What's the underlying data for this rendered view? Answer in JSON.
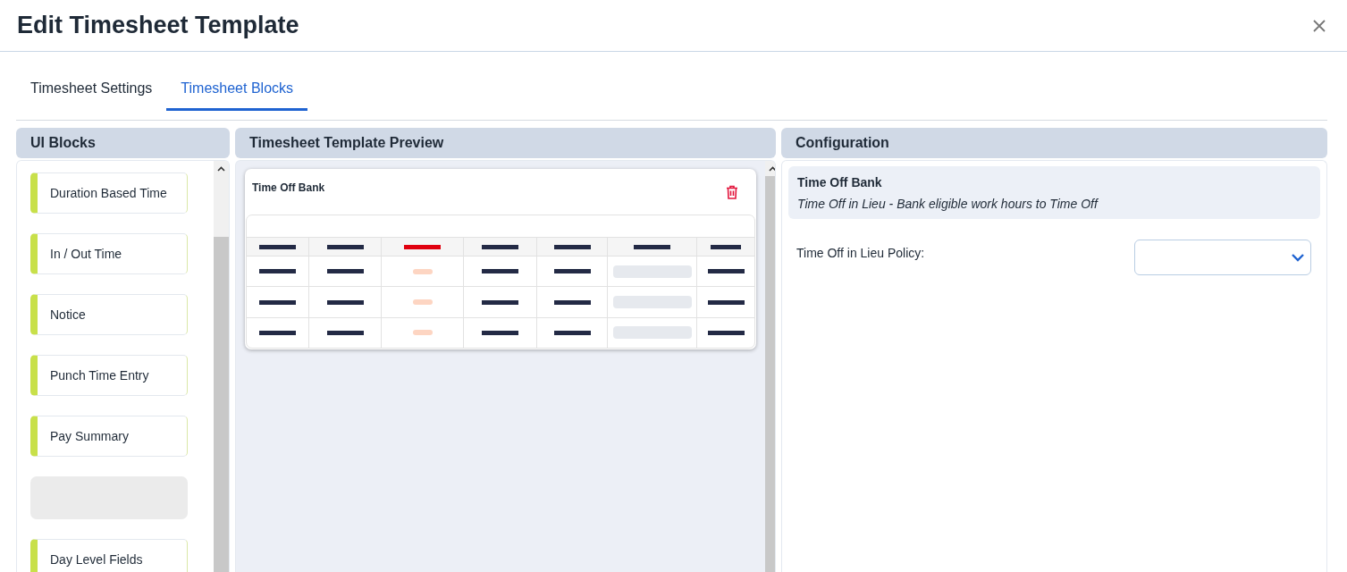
{
  "dialog": {
    "title": "Edit Timesheet Template"
  },
  "tabs": [
    {
      "label": "Timesheet Settings",
      "selected": false
    },
    {
      "label": "Timesheet Blocks",
      "selected": true
    }
  ],
  "ui_blocks": {
    "title": "UI Blocks",
    "items": [
      {
        "kind": "block",
        "label": "Duration Based Time"
      },
      {
        "kind": "block",
        "label": "In / Out Time"
      },
      {
        "kind": "block",
        "label": "Notice"
      },
      {
        "kind": "block",
        "label": "Punch Time Entry"
      },
      {
        "kind": "block",
        "label": "Pay Summary"
      },
      {
        "kind": "placeholder"
      },
      {
        "kind": "block",
        "label": "Day Level Fields"
      }
    ]
  },
  "preview": {
    "title": "Timesheet Template Preview",
    "card": {
      "title": "Time Off Bank"
    }
  },
  "configuration": {
    "title": "Configuration",
    "block": {
      "title": "Time Off Bank",
      "description": "Time Off in Lieu - Bank eligible work hours to Time Off"
    },
    "fields": [
      {
        "label": "Time Off in Lieu Policy:"
      }
    ]
  }
}
